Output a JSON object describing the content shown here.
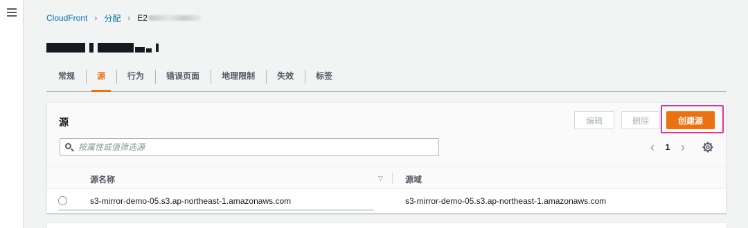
{
  "breadcrumb": {
    "items": [
      "CloudFront",
      "分配"
    ],
    "current": "E2"
  },
  "tabs": [
    "常规",
    "源",
    "行为",
    "错误页面",
    "地理限制",
    "失效",
    "标签"
  ],
  "active_tab": "源",
  "panel": {
    "title": "源",
    "edit_label": "编辑",
    "delete_label": "删除",
    "create_label": "创建源",
    "search_placeholder": "按属性或值筛选源"
  },
  "pagination": {
    "prev": "‹",
    "current_page": "1",
    "next": "›"
  },
  "table": {
    "columns": [
      "源名称",
      "源域"
    ],
    "rows": [
      {
        "name": "s3-mirror-demo-05.s3.ap-northeast-1.amazonaws.com",
        "domain": "s3-mirror-demo-05.s3.ap-northeast-1.amazonaws.com"
      }
    ]
  },
  "colors": {
    "accent": "#ec7211",
    "link": "#0073bb",
    "highlight": "#e6338a"
  },
  "icons": [
    "menu-icon",
    "chevron-right-icon",
    "search-icon",
    "sort-down-icon",
    "settings-icon"
  ]
}
